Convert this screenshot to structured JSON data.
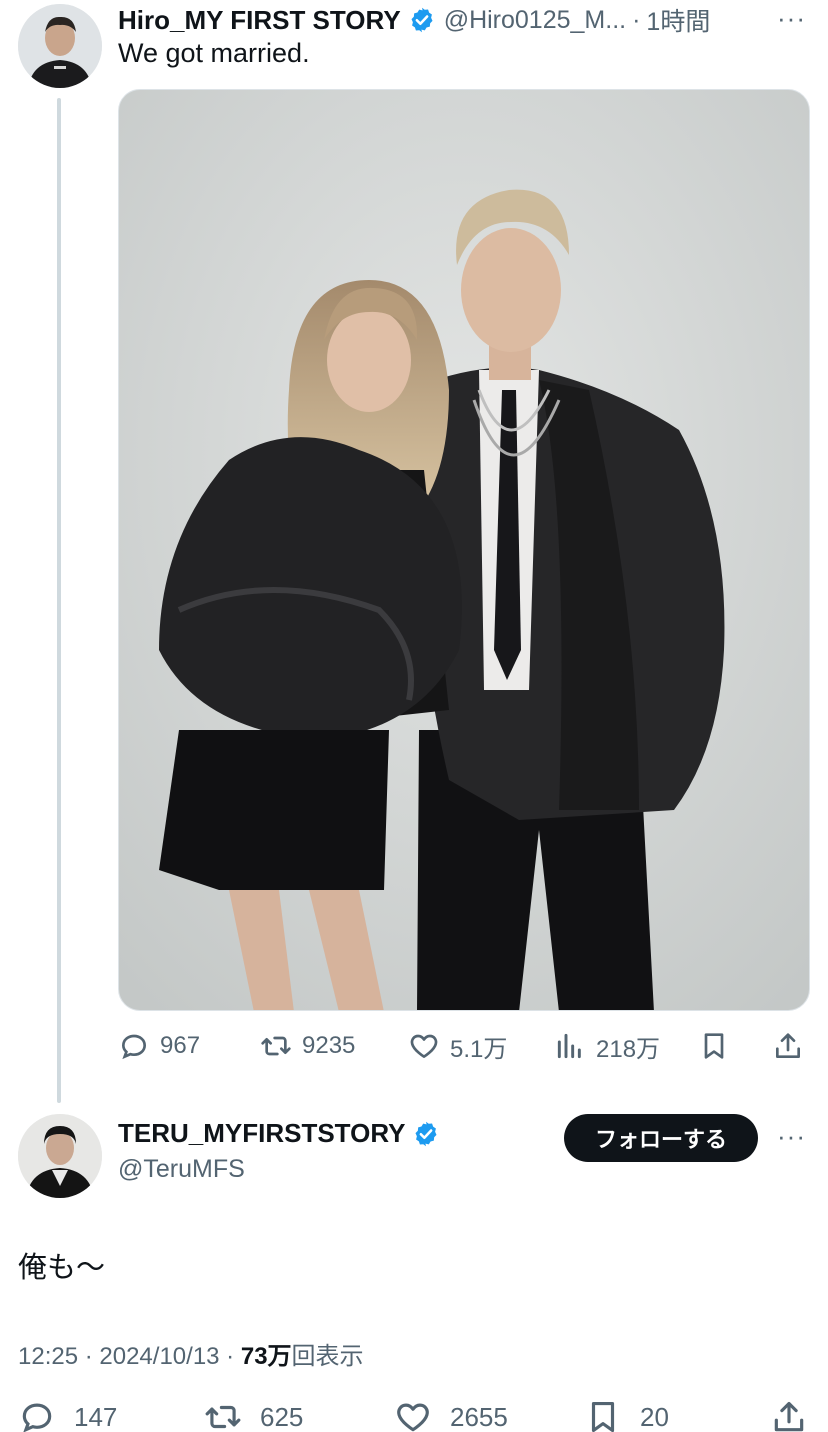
{
  "tweet1": {
    "display_name": "Hiro_MY FIRST STORY",
    "handle": "@Hiro0125_M...",
    "separator": "·",
    "time": "1時間",
    "text": "We got married.",
    "actions": {
      "replies": "967",
      "retweets": "9235",
      "likes": "5.1万",
      "views": "218万"
    }
  },
  "tweet2": {
    "display_name": "TERU_MYFIRSTSTORY",
    "handle": "@TeruMFS",
    "follow_label": "フォローする",
    "text": "俺も〜",
    "meta": {
      "time": "12:25",
      "sep1": " · ",
      "date": "2024/10/13",
      "sep2": " · ",
      "views_count": "73万",
      "views_label": "回表示"
    },
    "actions": {
      "replies": "147",
      "retweets": "625",
      "likes": "2655",
      "bookmarks": "20"
    }
  },
  "more_label": "···",
  "icons": {
    "verified": "verified-badge-icon",
    "reply": "reply-icon",
    "retweet": "retweet-icon",
    "like": "heart-icon",
    "views": "views-chart-icon",
    "bookmark": "bookmark-icon",
    "share": "share-icon"
  },
  "colors": {
    "verified": "#1d9bf0",
    "text": "#0f1419",
    "secondary": "#536471",
    "thread_line": "#cfd9de",
    "follow_bg": "#0f1419"
  }
}
